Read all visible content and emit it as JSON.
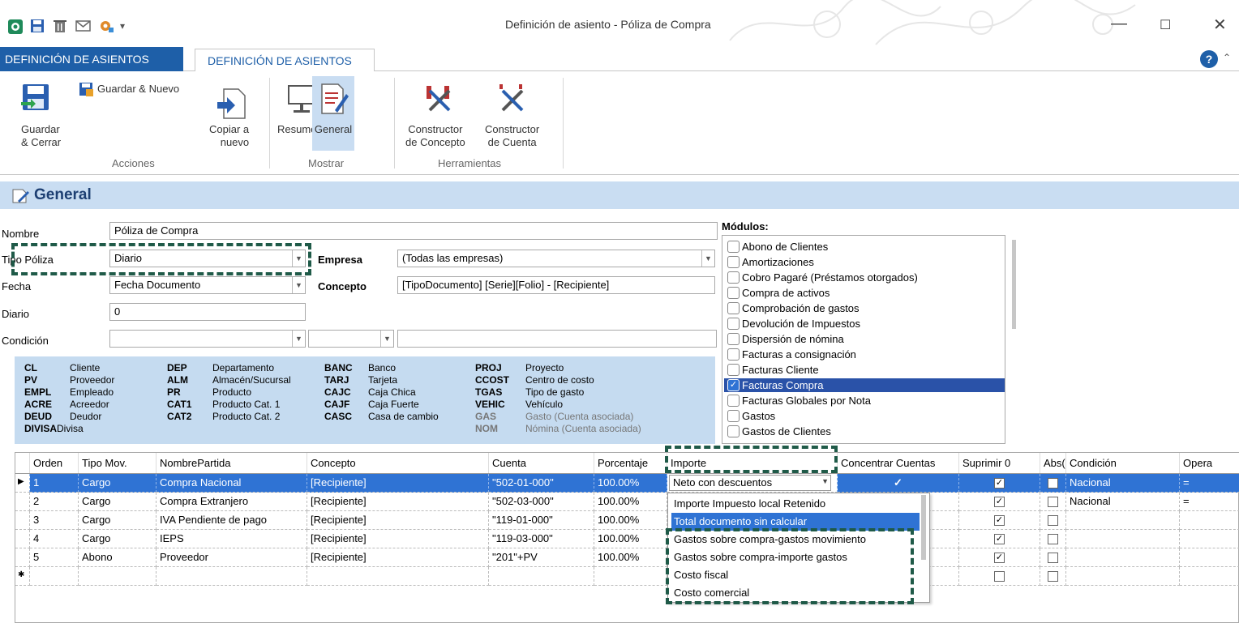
{
  "window": {
    "title": "Definición de asiento - Póliza de Compra",
    "minimize": "—",
    "maximize": "☐",
    "close": "✕"
  },
  "tabs": {
    "file": "DEFINICIÓN DE ASIENTOS",
    "active": "DEFINICIÓN DE ASIENTOS"
  },
  "ribbon": {
    "guardar_nuevo": "Guardar & Nuevo",
    "guardar_cerrar_1": "Guardar",
    "guardar_cerrar_2": "& Cerrar",
    "copiar_1": "Copiar a",
    "copiar_2": "nuevo",
    "resumen": "Resumen",
    "general": "General",
    "const_concepto_1": "Constructor",
    "const_concepto_2": "de Concepto",
    "const_cuenta_1": "Constructor",
    "const_cuenta_2": "de Cuenta",
    "group_acciones": "Acciones",
    "group_mostrar": "Mostrar",
    "group_herramientas": "Herramientas"
  },
  "section": {
    "title": "General"
  },
  "form": {
    "nombre_label": "Nombre",
    "nombre_value": "Póliza de Compra",
    "tipo_label": "Tipo Póliza",
    "tipo_value": "Diario",
    "empresa_label": "Empresa",
    "empresa_value": "(Todas las empresas)",
    "fecha_label": "Fecha",
    "fecha_value": "Fecha Documento",
    "concepto_label": "Concepto",
    "concepto_value": "[TipoDocumento] [Serie][Folio] - [Recipiente]",
    "diario_label": "Diario",
    "diario_value": "0",
    "condicion_label": "Condición"
  },
  "legend": [
    [
      [
        "CL",
        "Cliente"
      ],
      [
        "PV",
        "Proveedor"
      ],
      [
        "EMPL",
        "Empleado"
      ],
      [
        "ACRE",
        "Acreedor"
      ],
      [
        "DEUD",
        "Deudor"
      ],
      [
        "DIVISA",
        "Divisa"
      ]
    ],
    [
      [
        "DEP",
        "Departamento"
      ],
      [
        "ALM",
        "Almacén/Sucursal"
      ],
      [
        "PR",
        "Producto"
      ],
      [
        "CAT1",
        "Producto Cat. 1"
      ],
      [
        "CAT2",
        "Producto Cat. 2"
      ]
    ],
    [
      [
        "BANC",
        "Banco"
      ],
      [
        "TARJ",
        "Tarjeta"
      ],
      [
        "CAJC",
        "Caja Chica"
      ],
      [
        "CAJF",
        "Caja Fuerte"
      ],
      [
        "CASC",
        "Casa de cambio"
      ]
    ],
    [
      [
        "PROJ",
        "Proyecto"
      ],
      [
        "CCOST",
        "Centro de costo"
      ],
      [
        "TGAS",
        "Tipo de gasto"
      ],
      [
        "VEHIC",
        "Vehículo"
      ],
      [
        "GAS",
        "Gasto (Cuenta asociada)"
      ],
      [
        "NOM",
        "Nómina (Cuenta asociada)"
      ]
    ]
  ],
  "modules": {
    "label": "Módulos:",
    "items": [
      "Abono de Clientes",
      "Amortizaciones",
      "Cobro Pagaré (Préstamos otorgados)",
      "Compra de activos",
      "Comprobación de gastos",
      "Devolución de Impuestos",
      "Dispersión de nómina",
      "Facturas a consignación",
      "Facturas Cliente",
      "Facturas Compra",
      "Facturas Globales por Nota",
      "Gastos",
      "Gastos de Clientes"
    ],
    "checked_mark": "✓"
  },
  "grid": {
    "headers": [
      "Orden",
      "Tipo Mov.",
      "NombrePartida",
      "Concepto",
      "Cuenta",
      "Porcentaje",
      "Importe",
      "Concentrar Cuentas",
      "Suprimir 0",
      "Abs()",
      "Condición",
      "Opera"
    ],
    "rows": [
      [
        "1",
        "Cargo",
        "Compra Nacional",
        "[Recipiente]",
        "\"502-01-000\"",
        "100.00%",
        "Neto con descuentos",
        "",
        "",
        "",
        "Nacional",
        "="
      ],
      [
        "2",
        "Cargo",
        "Compra Extranjero",
        "[Recipiente]",
        "\"502-03-000\"",
        "100.00%",
        "",
        "",
        "",
        "",
        "Nacional",
        "="
      ],
      [
        "3",
        "Cargo",
        "IVA Pendiente de pago",
        "[Recipiente]",
        "\"119-01-000\"",
        "100.00%",
        "",
        "",
        "",
        "",
        "",
        ""
      ],
      [
        "4",
        "Cargo",
        "IEPS",
        "[Recipiente]",
        "\"119-03-000\"",
        "100.00%",
        "",
        "",
        "",
        "",
        "",
        ""
      ],
      [
        "5",
        "Abono",
        "Proveedor",
        "[Recipiente]",
        "\"201\"+PV",
        "100.00%",
        "",
        "",
        "",
        "",
        "",
        ""
      ]
    ],
    "current_marker": "▶",
    "new_marker": "✱",
    "check": "✓"
  },
  "importe_dropdown": {
    "options": [
      "Importe Impuesto local Retenido",
      "Total documento sin calcular",
      "Gastos sobre compra-gastos movimiento",
      "Gastos sobre compra-importe gastos",
      "Costo fiscal",
      "Costo comercial"
    ]
  }
}
